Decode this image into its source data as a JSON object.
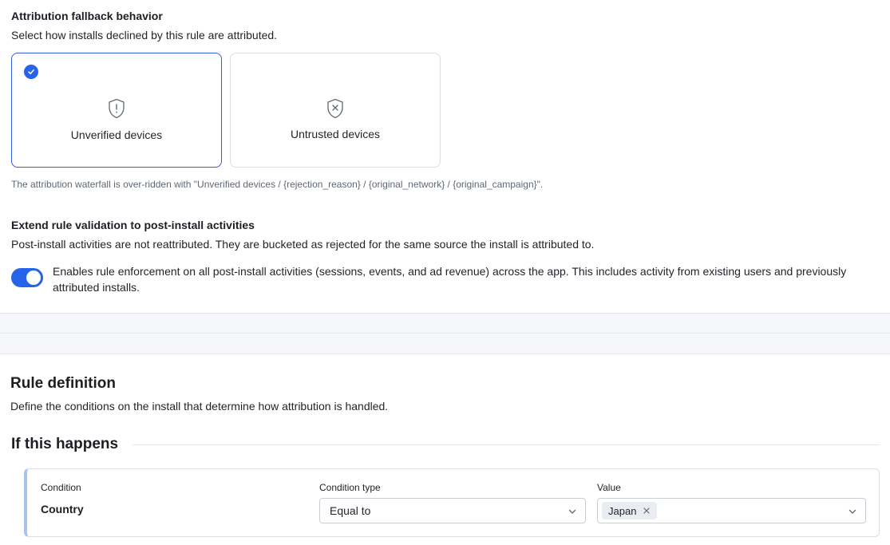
{
  "fallback": {
    "title": "Attribution fallback behavior",
    "subtitle": "Select how installs declined by this rule are attributed.",
    "options": [
      {
        "label": "Unverified devices",
        "icon": "shield-exclamation-icon",
        "selected": true
      },
      {
        "label": "Untrusted devices",
        "icon": "shield-x-icon",
        "selected": false
      }
    ],
    "note": "The attribution waterfall is over-ridden with \"Unverified devices / {rejection_reason} / {original_network} / {original_campaign}\"."
  },
  "extend": {
    "title": "Extend rule validation to post-install activities",
    "subtitle": "Post-install activities are not reattributed. They are bucketed as rejected for the same source the install is attributed to.",
    "toggle_on": true,
    "toggle_text": "Enables rule enforcement on all post-install activities (sessions, events, and ad revenue) across the app. This includes activity from existing users and previously attributed installs."
  },
  "rule": {
    "title": "Rule definition",
    "subtitle": "Define the conditions on the install that determine how attribution is handled.",
    "section_title": "If this happens",
    "condition": {
      "condition_label": "Condition",
      "condition_value": "Country",
      "type_label": "Condition type",
      "type_value": "Equal to",
      "value_label": "Value",
      "value_chips": [
        "Japan"
      ]
    }
  },
  "colors": {
    "accent": "#2563eb",
    "selected_border": "#2f5fd8",
    "condition_bar": "#a9c3f0"
  }
}
